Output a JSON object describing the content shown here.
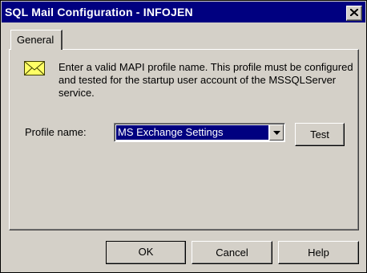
{
  "window": {
    "title": "SQL Mail Configuration - INFOJEN"
  },
  "tabs": [
    {
      "label": "General",
      "selected": true
    }
  ],
  "general": {
    "info_icon": "envelope-icon",
    "info_text": "Enter a valid MAPI profile name.  This profile must be configured and tested for the startup user account of the MSSQLServer service.",
    "profile_label": "Profile name:",
    "profile_value": "MS Exchange Settings",
    "test_label": "Test"
  },
  "footer": {
    "ok_label": "OK",
    "cancel_label": "Cancel",
    "help_label": "Help"
  },
  "colors": {
    "titlebar": "#000080",
    "face": "#d4d0c8",
    "selection": "#000080",
    "envelope": "#ffff66"
  }
}
